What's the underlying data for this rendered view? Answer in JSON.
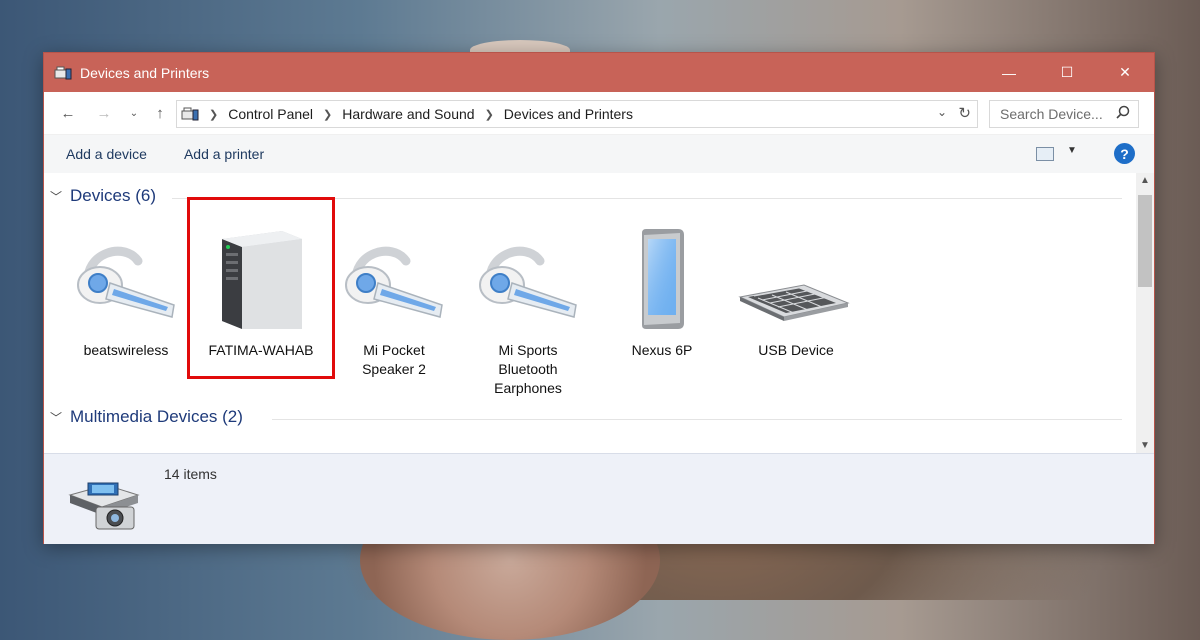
{
  "window": {
    "title": "Devices and Printers",
    "controls": {
      "minimize": "—",
      "maximize": "☐",
      "close": "✕"
    },
    "titlebar_color": "#c86358"
  },
  "address_bar": {
    "breadcrumbs": [
      "Control Panel",
      "Hardware and Sound",
      "Devices and Printers"
    ],
    "search_placeholder": "Search Device..."
  },
  "command_bar": {
    "add_device": "Add a device",
    "add_printer": "Add a printer",
    "help": "?"
  },
  "groups": [
    {
      "header": "Devices (6)",
      "devices": [
        {
          "name": "beatswireless",
          "icon": "headset-icon"
        },
        {
          "name": "FATIMA-WAHAB",
          "icon": "computer-tower-icon",
          "highlighted": true
        },
        {
          "name": "Mi Pocket Speaker 2",
          "line1": "Mi Pocket",
          "line2": "Speaker 2",
          "icon": "headset-icon"
        },
        {
          "name": "Mi Sports Bluetooth Earphones",
          "line1": "Mi Sports",
          "line2": "Bluetooth",
          "line3": "Earphones",
          "icon": "headset-icon"
        },
        {
          "name": "Nexus 6P",
          "icon": "phone-icon"
        },
        {
          "name": "USB Device",
          "icon": "keyboard-icon"
        }
      ]
    },
    {
      "header": "Multimedia Devices (2)"
    }
  ],
  "details_pane": {
    "count": "14 items",
    "icon": "printer-camera-icon"
  },
  "accent_colors": {
    "highlight_box": "#e10b0b",
    "link_text": "#1f3a60",
    "group_header": "#1e3a7a"
  }
}
